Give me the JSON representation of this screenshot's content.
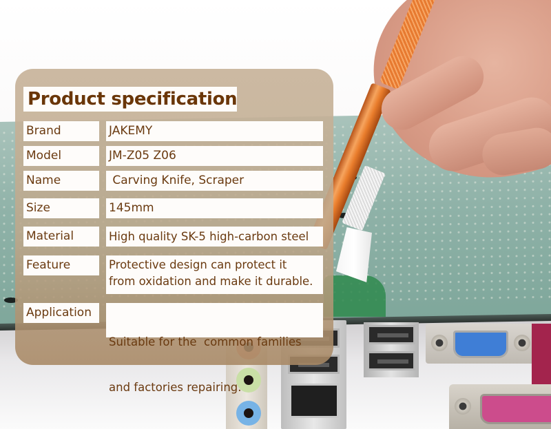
{
  "panel": {
    "title": "Product specification",
    "rows": [
      {
        "label": "Brand",
        "value": "JAKEMY"
      },
      {
        "label": "Model",
        "value": "JM-Z05 Z06"
      },
      {
        "label": "Name",
        "value": " Carving Knife, Scraper"
      },
      {
        "label": "Size",
        "value": "145mm"
      },
      {
        "label": "Material",
        "value": "High quality SK-5 high-carbon steel"
      },
      {
        "label": "Feature",
        "value_lines": [
          "Protective design can protect it",
          "from oxidation and make it durable."
        ]
      },
      {
        "label": "Application",
        "value_lines": [
          "Suitable for the  common families",
          "and factories repairing."
        ]
      }
    ]
  },
  "photo": {
    "subject": "hand holding orange carving knife scraping a green circuit board",
    "colors": {
      "panel_bg": "#c8b49b",
      "title_text": "#6a3608",
      "cell_text": "#6a3a10",
      "cell_bg": "#fefcfa",
      "knife_handle": "#e97d2c",
      "pcb": "#8fb2a8"
    }
  }
}
